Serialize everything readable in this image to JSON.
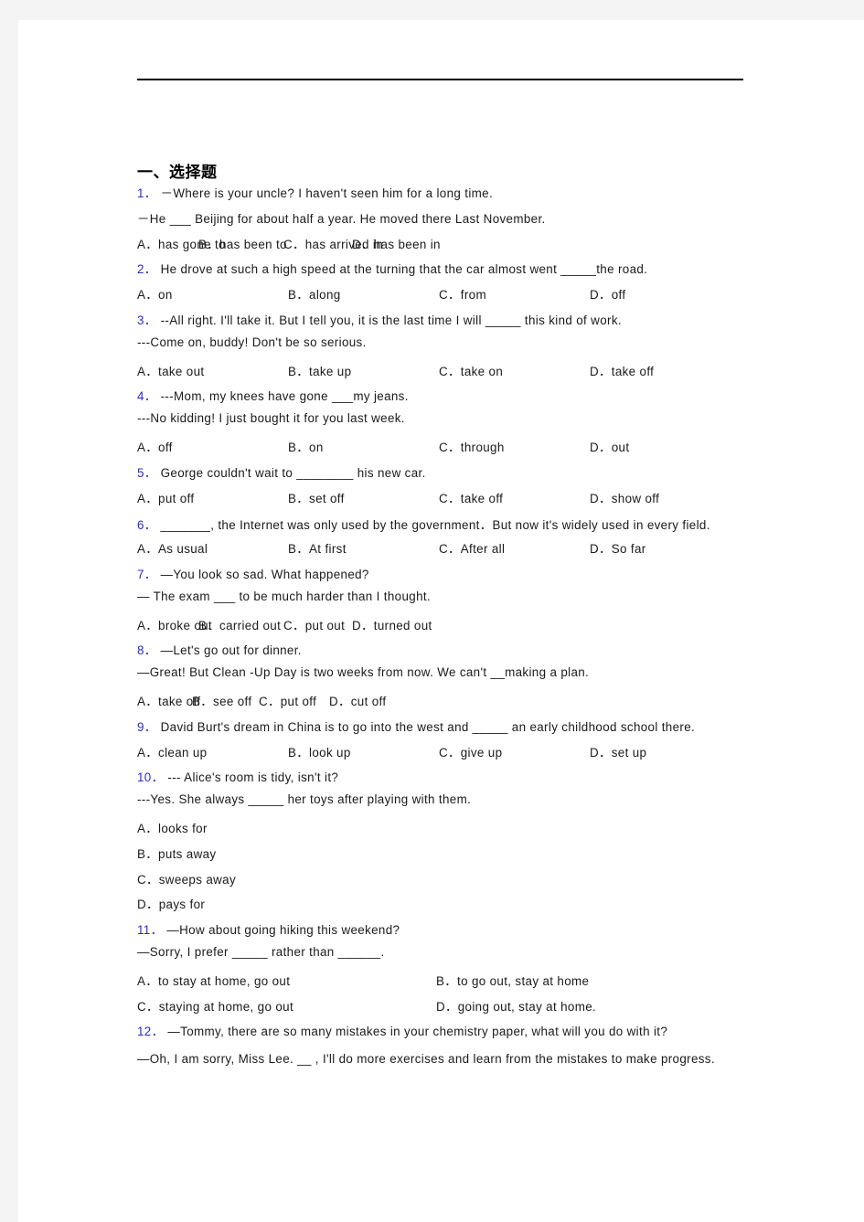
{
  "page": {
    "background": "#ffffff",
    "outer_background": "#f4f4f4",
    "qnum_color": "#2b2bc8",
    "text_color": "#1a1a1a"
  },
  "heading": "一、选择题",
  "questions": [
    {
      "num": "1．",
      "lines": [
        "－Where is your uncle? I haven't seen him for a long time.",
        "－He ___    Beijing for about half a year. He moved there Last November."
      ],
      "options": [
        "A．has gone to",
        "B．has been to",
        "C．has arrived in",
        "D．has been in"
      ],
      "option_layout": "c4tight"
    },
    {
      "num": "2．",
      "lines": [
        "He drove at such a high speed at the turning that the car almost went _____the road."
      ],
      "options": [
        "A．on",
        "B．along",
        "C．from",
        "D．off"
      ],
      "option_layout": "c4"
    },
    {
      "num": "3．",
      "lines": [
        "--All right. I'll take it. But I tell you, it is the last time I will _____ this kind of work.",
        "---Come on, buddy! Don't be so serious."
      ],
      "options": [
        "A．take out",
        "B．take up",
        "C．take on",
        "D．take off"
      ],
      "option_layout": "c4"
    },
    {
      "num": "4．",
      "lines": [
        "---Mom, my knees have gone ___my jeans.",
        "---No kidding! I just bought it for you last week."
      ],
      "options": [
        "A．off",
        "B．on",
        "C．through",
        "D．out"
      ],
      "option_layout": "c4"
    },
    {
      "num": "5．",
      "lines": [
        "George couldn't wait to ________ his new car."
      ],
      "options": [
        "A．put off",
        "B．set off",
        "C．take off",
        "D．show off"
      ],
      "option_layout": "c4"
    },
    {
      "num": "6．",
      "lines": [
        "_______, the Internet was only used by the government．But now it's widely used in every field."
      ],
      "options": [
        "A．As usual",
        "B．At first",
        "C．After all",
        "D．So far"
      ],
      "option_layout": "c4",
      "wrap": true
    },
    {
      "num": "7．",
      "lines": [
        "—You look so sad. What happened?",
        "— The exam ___   to be much harder than I thought."
      ],
      "options": [
        "A．broke out",
        "B．carried out",
        "C．put out",
        "D．turned out"
      ],
      "option_layout": "c4tight"
    },
    {
      "num": "8．",
      "lines": [
        "—Let's go out for dinner.",
        "—Great! But Clean -Up Day is two weeks from now. We can't  __making a plan."
      ],
      "options": [
        "A．take off",
        "B．see off",
        "C．put off",
        "D．cut off"
      ],
      "option_layout": "c4tight2"
    },
    {
      "num": "9．",
      "lines": [
        "David Burt's dream in China is to go into the west and _____ an early childhood school there."
      ],
      "options": [
        "A．clean up",
        "B．look up",
        "C．give up",
        "D．set up"
      ],
      "option_layout": "c4"
    },
    {
      "num": "10．",
      "lines": [
        "--- Alice's room is tidy, isn't it?",
        "---Yes. She always _____ her toys after playing with them."
      ],
      "options": [
        "A．looks for",
        "B．puts away",
        "C．sweeps away",
        "D．pays for"
      ],
      "option_layout": "stacked"
    },
    {
      "num": "11．",
      "lines": [
        "—How about going hiking this weekend?",
        "—Sorry, I prefer _____ rather than ______."
      ],
      "options": [
        "A．to stay at home, go out",
        "B．to go out, stay at home",
        "C．staying at home, go out",
        "D．going out, stay at home."
      ],
      "option_layout": "c2x2"
    },
    {
      "num": "12．",
      "lines": [
        "—Tommy, there are so many mistakes in your chemistry paper, what will you do with it?",
        "—Oh, I am sorry, Miss Lee. __ , I'll do more exercises and learn from the mistakes to make progress."
      ],
      "options": [],
      "option_layout": "none",
      "wrap_second": true
    }
  ]
}
